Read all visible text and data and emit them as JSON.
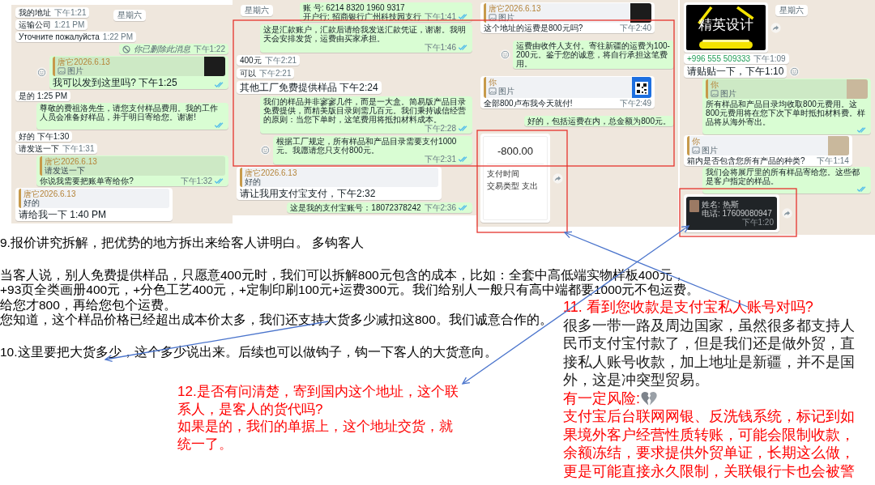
{
  "chats": [
    {
      "date_label": "星期六",
      "messages": [
        {
          "kind": "text",
          "outgoing": false,
          "text": "我的地址",
          "time": "下午1:21",
          "large": false,
          "read": false
        },
        {
          "kind": "text",
          "outgoing": false,
          "text": "运输公司",
          "time": "1:21 PM",
          "large": false,
          "read": false
        },
        {
          "kind": "text",
          "outgoing": false,
          "text": "Уточните пожалуйста",
          "time": "1:22 PM",
          "large": false,
          "read": false
        },
        {
          "kind": "deleted",
          "outgoing": true,
          "text": "你已删除此消息",
          "time": "下午1:22",
          "read": false
        },
        {
          "kind": "quote",
          "outgoing": true,
          "quote": {
            "author": "唐它2026.6.13",
            "kind": "photo",
            "text": "图片",
            "thumbnail": {
              "kind": "screenshot"
            }
          },
          "text": "我可以发到这里吗? 下午1:25",
          "large": true,
          "read": true,
          "side_button": {
            "kind": "react"
          }
        },
        {
          "kind": "text",
          "outgoing": false,
          "text": "是的 1:25 PM",
          "large": false,
          "read": false
        },
        {
          "kind": "text",
          "outgoing": true,
          "text": "尊敬的费祖洛先生，请您支付样品费用。我的工作人员会准备好样品，并于明日寄给您。谢谢!",
          "large": false,
          "read": true
        },
        {
          "kind": "text",
          "outgoing": false,
          "text": "好的 下午1:30",
          "large": false,
          "read": false
        },
        {
          "kind": "text",
          "outgoing": false,
          "text": "请发送一下",
          "time": "下午1:31",
          "large": false,
          "read": false
        },
        {
          "kind": "quote",
          "outgoing": true,
          "quote": {
            "author": "唐它2026.6.13",
            "kind": "text",
            "text": "请发送一下"
          },
          "text": "你说我需要把账单寄给你?",
          "time": "下午1:32",
          "large": false,
          "read": true
        },
        {
          "kind": "quote",
          "outgoing": false,
          "quote": {
            "author": "唐它2026.6.13",
            "kind": "text",
            "text": "好的"
          },
          "text": "请给我一下 1:40 PM",
          "large": true,
          "read": false
        }
      ]
    },
    {
      "date_label": "星期六",
      "messages": [
        {
          "kind": "text",
          "outgoing": true,
          "text": "账 号: 6214 8320 1960 9317\n开户行: 招商银行广州科技园支行",
          "time": "下午1:41",
          "large": false,
          "read": true
        },
        {
          "kind": "text",
          "outgoing": true,
          "text": "这是汇款账户，汇款后请给我发送汇款凭证，谢谢。我明天会安排发货，运费由买家承担。",
          "time": "下午1:46",
          "large": false,
          "read": true
        },
        {
          "kind": "text",
          "outgoing": false,
          "text": "400元",
          "time": "下午2:21",
          "large": false,
          "read": false
        },
        {
          "kind": "text",
          "outgoing": false,
          "text": "可以",
          "time": "下午2:21",
          "large": false,
          "read": false
        },
        {
          "kind": "text",
          "outgoing": false,
          "text": "其他工厂免费提供样品 下午2:24",
          "large": true,
          "read": false
        },
        {
          "kind": "text",
          "outgoing": true,
          "text": "我们的样品并非寥寥几件，而是一大盒。简易版产品目录免费提供，而精美版目录则需几百元。我们秉持诚信经营的原则：当您下单时，这笔费用将抵扣材料成本。",
          "time": "下午2:28",
          "large": false,
          "read": true
        },
        {
          "kind": "text",
          "outgoing": true,
          "text": "根据工厂规定，所有样品和产品目录需要支付1000元。我愿请您只支付800元。",
          "time": "下午2:31",
          "large": false,
          "read": true,
          "side_button": {
            "kind": "react"
          }
        },
        {
          "kind": "quote",
          "outgoing": false,
          "quote": {
            "author": "唐它2026.6.13",
            "kind": "text",
            "text": "好的"
          },
          "text": "请让我用支付宝支付，下午2:32",
          "large": true,
          "read": false
        },
        {
          "kind": "text",
          "outgoing": true,
          "text": "这是我的支付宝账号：18072378242",
          "time": "下午2:36",
          "large": false,
          "read": true
        }
      ]
    },
    {
      "messages": [
        {
          "kind": "quote",
          "outgoing": false,
          "quote": {
            "author": "唐它2026.6.13",
            "kind": "photo",
            "text": "图片",
            "thumbnail": {
              "kind": "screenshot"
            }
          },
          "text": "这个地址的运费是800元吗?",
          "time": "下午2:40",
          "large": false,
          "read": false
        },
        {
          "kind": "text",
          "outgoing": true,
          "text": "运费由收件人支付。寄往新疆的运费为100-200元。鉴于您的诚意，将自行承担这笔费用。",
          "large": false,
          "read": false,
          "side_button": {
            "kind": "react"
          }
        },
        {
          "kind": "quote",
          "outgoing": false,
          "quote": {
            "author": "你",
            "kind": "photo",
            "text": "图片",
            "thumbnail": {
              "kind": "qr"
            }
          },
          "text": "全部800卢布我今天就付!",
          "time": "下午2:49",
          "large": false,
          "read": false
        },
        {
          "kind": "text",
          "outgoing": true,
          "text": "好的，包括运费在内，总金额为800元。",
          "large": false,
          "read": false
        },
        {
          "kind": "receipt",
          "outgoing": false,
          "amount": "-800.00",
          "rows": [
            "支付时间",
            "交易类型 支出"
          ],
          "side_button": {
            "kind": "forward"
          }
        }
      ]
    },
    {
      "date_label": "星期六",
      "messages": [
        {
          "kind": "logo_image",
          "outgoing": false,
          "text": "精英设计",
          "side_button": {
            "kind": "forward"
          }
        },
        {
          "kind": "phone",
          "outgoing": false,
          "text": "+996 555 509333",
          "time": "下午1:09",
          "read": false
        },
        {
          "kind": "text",
          "outgoing": false,
          "text": "请贴贴一下，下午1:10",
          "large": true,
          "read": false,
          "side_button": {
            "kind": "react"
          }
        },
        {
          "kind": "quote",
          "outgoing": true,
          "quote": {
            "author": "你",
            "kind": "photo",
            "text": "图片",
            "thumbnail": {
              "kind": "photo"
            }
          },
          "text": "所有样品和产品目录均收取800元费用。这800元费用将在您下次下单时抵扣材料费。样品将从海外寄出。",
          "large": false,
          "read": true
        },
        {
          "kind": "quote",
          "outgoing": false,
          "quote": {
            "author": "你",
            "kind": "photo",
            "text": "图片",
            "thumbnail": {
              "kind": "photo"
            }
          },
          "text": "箱内是否包含您所有产品的种类?",
          "time": "下午1:14",
          "large": false,
          "read": false
        },
        {
          "kind": "text",
          "outgoing": true,
          "text": "我们会将展厅里的所有样品寄给您。这些都是客户指定的样品。",
          "large": false,
          "read": true
        },
        {
          "kind": "address_card",
          "outgoing": false,
          "lines": [
            "姓名: 热斯",
            "电话: 17609080947"
          ],
          "time": "下午1:20",
          "side_button": {
            "kind": "forward"
          }
        }
      ]
    }
  ],
  "notes": {
    "point_9": "9.报价讲究拆解，把优势的地方拆出来给客人讲明白。 多钩客人",
    "pricing_lines": [
      "当客人说，别人免费提供样品，只愿意400元时，我们可以拆解800元包含的成本，比如：全套中高低端实物样板400元，",
      "+93页全类画册400元，+分色工艺400元，+定制印刷100元+运费300元。我们给别人一般只有高中端都要1000元不包运费。"
    ],
    "closing_lines": [
      "给您才800，再给您包个运费。",
      "您知道，这个样品价格已经超出成本价太多，我们还支持大货多少减扣这800。我们诚意合作的。"
    ],
    "point_10": "10.这里要把大货多少，这个多少说出来。后续也可以做钩子，钩一下客人的大货意向。",
    "point_12": {
      "question_lines": [
        "12.是否有问清楚，寄到国内这个地址，这个联",
        "系人，是客人的货代吗?"
      ],
      "answer_lines": [
        "如果是的，我们的单据上，这个地址交货，就",
        "统一了。"
      ]
    },
    "point_11": {
      "title": "11. 看到您收款是支付宝私人账号对吗?",
      "body_lines": [
        "很多一带一路及周边国家，虽然很多都支持人",
        "民币支付宝付款了，但是我们还是做外贸，直",
        "接私人账号收款，加上地址是新疆，并不是国",
        "外，这是冲突型贸易。"
      ],
      "risk_label": "有一定风险:",
      "risk_lines": [
        "支付宝后台联网网银、反洗钱系统，标记到如",
        "果境外客户经营性质转账，可能会限制收款，",
        "余额冻结，要求提供外贸单证，长期这么做，",
        "更是可能直接永久限制，关联银行卡也会被警"
      ]
    }
  }
}
